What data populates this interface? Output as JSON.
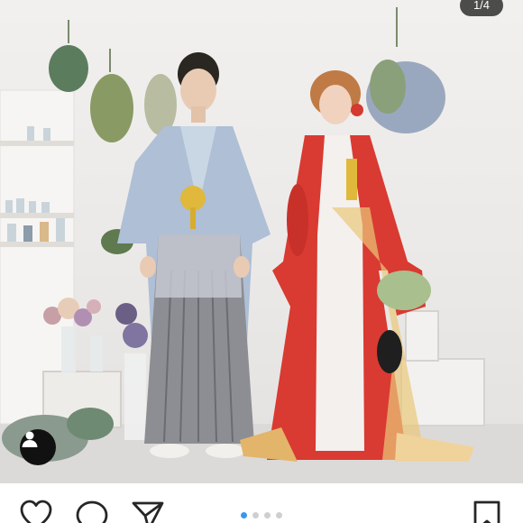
{
  "post": {
    "image_counter": "1/4",
    "carousel": {
      "total": 4,
      "active_index": 0
    }
  },
  "icons": {
    "user_tag": "user-tag-icon",
    "like": "heart-icon",
    "comment": "comment-bubble-icon",
    "share": "paper-plane-icon",
    "save": "bookmark-icon"
  },
  "colors": {
    "dot_active": "#3897f0",
    "dot_inactive": "#cfcfcf",
    "counter_bg": "#1e1e1e"
  }
}
